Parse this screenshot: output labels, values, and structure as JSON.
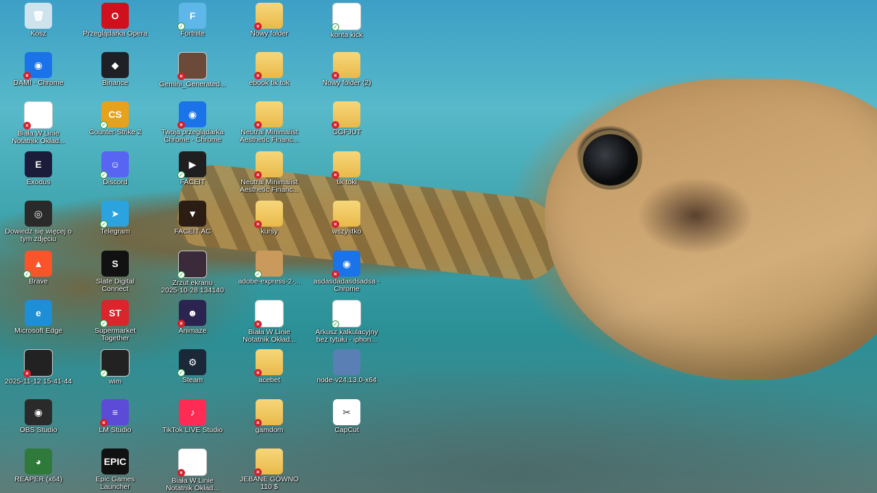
{
  "desktop": {
    "icons": [
      {
        "label": "Kosz",
        "icon": "recycle-bin-icon",
        "color": "#cfe3ef",
        "glyph": "🗑",
        "badge": ""
      },
      {
        "label": "Przeglądarka Opera",
        "icon": "opera-icon",
        "color": "#d0101c",
        "glyph": "O",
        "badge": ""
      },
      {
        "label": "Fortnite",
        "icon": "fortnite-icon",
        "color": "#5fb6e8",
        "glyph": "F",
        "badge": "ok"
      },
      {
        "label": "Nowy folder",
        "icon": "folder-icon",
        "color": "#e9b94a",
        "glyph": "",
        "badge": "err"
      },
      {
        "label": "konta kick",
        "icon": "document-icon",
        "color": "#ffffff",
        "glyph": "",
        "badge": "ok"
      },
      {
        "label": "DAMI - Chrome",
        "icon": "chrome-icon",
        "color": "#1a73e8",
        "glyph": "◉",
        "badge": "err"
      },
      {
        "label": "Binance",
        "icon": "binance-icon",
        "color": "#1e2026",
        "glyph": "◆",
        "badge": ""
      },
      {
        "label": "Gemini_Generated...",
        "icon": "image-file-icon",
        "color": "#6b4a3a",
        "glyph": "",
        "badge": "err"
      },
      {
        "label": "ebook tik tok",
        "icon": "folder-icon",
        "color": "#e9b94a",
        "glyph": "",
        "badge": "err"
      },
      {
        "label": "Nowy folder (2)",
        "icon": "folder-icon",
        "color": "#e9b94a",
        "glyph": "",
        "badge": "err"
      },
      {
        "label": "Biała W Linie\nNotatnik Okład...",
        "icon": "pdf-file-icon",
        "color": "#ffffff",
        "glyph": "",
        "badge": "err"
      },
      {
        "label": "Counter-Strike 2",
        "icon": "counter-strike-icon",
        "color": "#e6a21c",
        "glyph": "CS",
        "badge": "ok"
      },
      {
        "label": "Twoja przeglądarka\nChrome - Chrome",
        "icon": "chrome-icon",
        "color": "#1a73e8",
        "glyph": "◉",
        "badge": "err"
      },
      {
        "label": "Neutral Minimalist\nAesthetic Financ...",
        "icon": "folder-icon",
        "color": "#e9b94a",
        "glyph": "",
        "badge": "err"
      },
      {
        "label": "GGFJUT",
        "icon": "folder-icon",
        "color": "#e9b94a",
        "glyph": "",
        "badge": "err"
      },
      {
        "label": "Exodus",
        "icon": "exodus-icon",
        "color": "#1b1b3a",
        "glyph": "E",
        "badge": ""
      },
      {
        "label": "Discord",
        "icon": "discord-icon",
        "color": "#5865f2",
        "glyph": "☺",
        "badge": "ok"
      },
      {
        "label": "FACEIT",
        "icon": "faceit-icon",
        "color": "#1f1f1f",
        "glyph": "▶",
        "badge": "ok"
      },
      {
        "label": "Neutral Minimalist\nAesthetic Financ...",
        "icon": "folder-icon",
        "color": "#e9b94a",
        "glyph": "",
        "badge": "err"
      },
      {
        "label": "tik toki",
        "icon": "folder-icon",
        "color": "#e9b94a",
        "glyph": "",
        "badge": "err"
      },
      {
        "label": "Dowiedz się więcej o\ntym zdjęciu",
        "icon": "camera-info-icon",
        "color": "#2a2a2a",
        "glyph": "◎",
        "badge": ""
      },
      {
        "label": "Telegram",
        "icon": "telegram-icon",
        "color": "#2aa3df",
        "glyph": "➤",
        "badge": "ok"
      },
      {
        "label": "FACEIT AC",
        "icon": "faceit-ac-icon",
        "color": "#2b1d14",
        "glyph": "▼",
        "badge": ""
      },
      {
        "label": "kursy",
        "icon": "folder-icon",
        "color": "#e9b94a",
        "glyph": "",
        "badge": "err"
      },
      {
        "label": "wszystko",
        "icon": "folder-icon",
        "color": "#e9b94a",
        "glyph": "",
        "badge": "err"
      },
      {
        "label": "Brave",
        "icon": "brave-icon",
        "color": "#fb542b",
        "glyph": "▲",
        "badge": "ok"
      },
      {
        "label": "Slate Digital\nConnect",
        "icon": "slate-digital-icon",
        "color": "#111111",
        "glyph": "S",
        "badge": ""
      },
      {
        "label": "Zrzut ekranu\n2025-10-28 134140",
        "icon": "screenshot-file-icon",
        "color": "#3a2a3a",
        "glyph": "",
        "badge": "ok"
      },
      {
        "label": "adobe-express-2-...",
        "icon": "package-icon",
        "color": "#c99a5b",
        "glyph": "",
        "badge": "ok"
      },
      {
        "label": "asdasdadasdsadsa -\nChrome",
        "icon": "chrome-icon",
        "color": "#1a73e8",
        "glyph": "◉",
        "badge": "err"
      },
      {
        "label": "Microsoft Edge",
        "icon": "edge-icon",
        "color": "#1d8fd6",
        "glyph": "e",
        "badge": ""
      },
      {
        "label": "Supermarket\nTogether",
        "icon": "supermarket-together-icon",
        "color": "#d9252b",
        "glyph": "ST",
        "badge": "ok"
      },
      {
        "label": "Animaze",
        "icon": "animaze-icon",
        "color": "#2c2450",
        "glyph": "☻",
        "badge": "err"
      },
      {
        "label": "Biała W Linie\nNotatnik Okład...",
        "icon": "pdf-file-icon",
        "color": "#ffffff",
        "glyph": "",
        "badge": "err"
      },
      {
        "label": "Arkusz kalkulacyjny\nbez tytułu - iphon...",
        "icon": "spreadsheet-icon",
        "color": "#ffffff",
        "glyph": "",
        "badge": "ok"
      },
      {
        "label": "2025-11-12 15-41-44",
        "icon": "video-file-icon",
        "color": "#222222",
        "glyph": "",
        "badge": "err"
      },
      {
        "label": "wim",
        "icon": "video-file-icon",
        "color": "#222222",
        "glyph": "",
        "badge": "ok"
      },
      {
        "label": "Steam",
        "icon": "steam-icon",
        "color": "#1b2838",
        "glyph": "⚙",
        "badge": "ok"
      },
      {
        "label": "acebet",
        "icon": "folder-icon",
        "color": "#e9b94a",
        "glyph": "",
        "badge": "err"
      },
      {
        "label": "node-v24.13.0-x64",
        "icon": "installer-icon",
        "color": "#5a7fb5",
        "glyph": "",
        "badge": ""
      },
      {
        "label": "OBS Studio",
        "icon": "obs-icon",
        "color": "#2a2a2a",
        "glyph": "◉",
        "badge": ""
      },
      {
        "label": "LM Studio",
        "icon": "lm-studio-icon",
        "color": "#5b4bd6",
        "glyph": "≡",
        "badge": "err"
      },
      {
        "label": "TikTok LIVE Studio",
        "icon": "tiktok-live-icon",
        "color": "#fe2c55",
        "glyph": "♪",
        "badge": ""
      },
      {
        "label": "gamdom",
        "icon": "folder-icon",
        "color": "#e9b94a",
        "glyph": "",
        "badge": "err"
      },
      {
        "label": "CapCut",
        "icon": "capcut-icon",
        "color": "#ffffff",
        "glyph": "✂",
        "badge": ""
      },
      {
        "label": "REAPER (x64)",
        "icon": "reaper-icon",
        "color": "#2f7a3a",
        "glyph": "◕",
        "badge": ""
      },
      {
        "label": "Epic Games\nLauncher",
        "icon": "epic-games-icon",
        "color": "#111111",
        "glyph": "EPIC",
        "badge": ""
      },
      {
        "label": "Biała W Linie\nNotatnik Okład...",
        "icon": "pdf-file-icon",
        "color": "#ffffff",
        "glyph": "",
        "badge": "err"
      },
      {
        "label": "JEBANE GÓWNO\n110 $",
        "icon": "folder-icon",
        "color": "#e9b94a",
        "glyph": "",
        "badge": "err"
      }
    ]
  }
}
